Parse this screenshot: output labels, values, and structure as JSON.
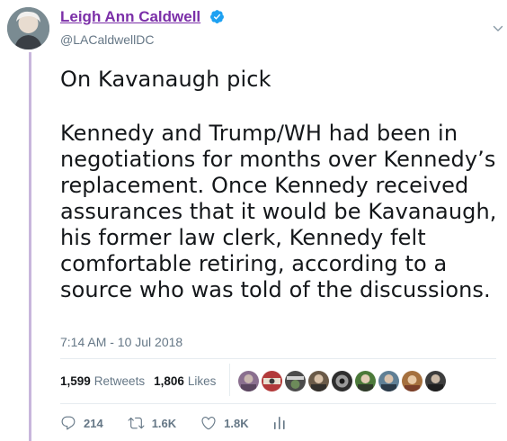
{
  "author": {
    "name": "Leigh Ann Caldwell",
    "handle": "@LACaldwellDC"
  },
  "tweet": {
    "line1": "On Kavanaugh pick",
    "body": "Kennedy and Trump/WH had been in\nnegotiations for months over Kennedy’s\nreplacement. Once Kennedy received\nassurances that it would be Kavanaugh,\nhis former law clerk, Kennedy felt\ncomfortable retiring, according to a\nsource who was told of the discussions.",
    "timestamp": "7:14 AM - 10 Jul 2018"
  },
  "stats": {
    "retweets_count": "1,599",
    "retweets_label": "Retweets",
    "likes_count": "1,806",
    "likes_label": "Likes"
  },
  "actions": {
    "reply_count": "214",
    "retweet_count": "1.6K",
    "like_count": "1.8K"
  },
  "colors": {
    "name": "#7b2fa8",
    "verified": "#1da1f2",
    "muted": "#657786",
    "thread_line": "#c8b6dc"
  },
  "icons": [
    "verified-badge-icon",
    "chevron-down-icon",
    "reply-icon",
    "retweet-icon",
    "like-icon",
    "analytics-icon"
  ]
}
